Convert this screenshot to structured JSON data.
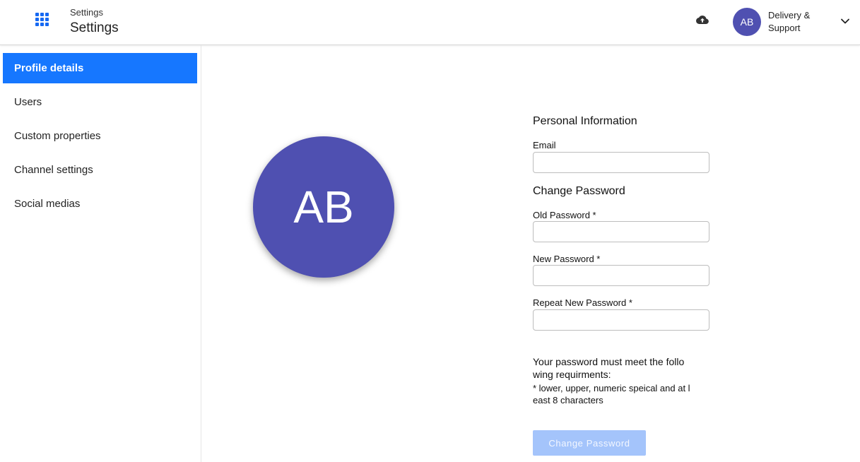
{
  "header": {
    "breadcrumb": "Settings",
    "title": "Settings",
    "user_initials": "AB",
    "org_name": "Delivery & Support"
  },
  "icons": {
    "apps": "apps-grid-icon",
    "upload": "cloud-upload-icon",
    "menu": "chevron-down-icon"
  },
  "sidebar": {
    "items": [
      {
        "label": "Profile details",
        "active": true
      },
      {
        "label": "Users",
        "active": false
      },
      {
        "label": "Custom properties",
        "active": false
      },
      {
        "label": "Channel settings",
        "active": false
      },
      {
        "label": "Social medias",
        "active": false
      }
    ]
  },
  "profile": {
    "avatar_initials": "AB"
  },
  "personal": {
    "title": "Personal Information",
    "email_label": "Email",
    "email_value": ""
  },
  "password": {
    "title": "Change Password",
    "old_label": "Old Password *",
    "new_label": "New Password *",
    "repeat_label": "Repeat New Password *",
    "requirements_main": "Your password must meet the follo wing requirments:",
    "requirements_detail": "* lower, upper, numeric speical and at l east 8 characters",
    "submit_label": "Change Password"
  },
  "colors": {
    "accent": "#1677ff",
    "avatar": "#4f50b1",
    "button_disabled": "#a4c4fb"
  }
}
